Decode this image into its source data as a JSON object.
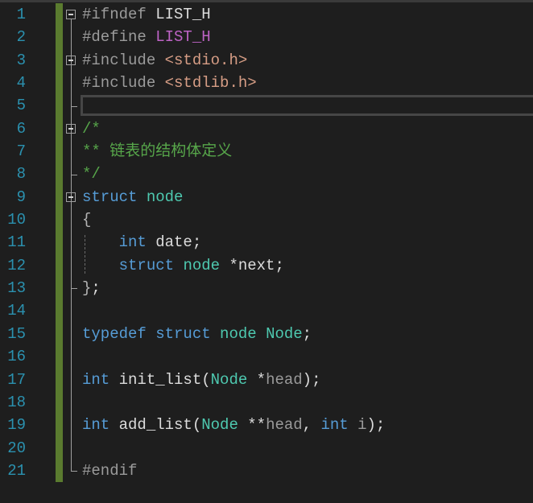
{
  "editor": {
    "current_line": 5,
    "colors": {
      "line_number": "#2b91af",
      "keyword": "#569cd6",
      "type": "#4ec9b0",
      "comment": "#57a64a",
      "string": "#d69d85",
      "macro": "#bd63c5",
      "preprocessor": "#9b9b9b",
      "change_bar": "#5a7b2f",
      "background": "#1e1e1e"
    },
    "lines": [
      {
        "n": "1",
        "tokens": [
          [
            "#ifndef ",
            "pp"
          ],
          [
            "LIST_H",
            "pl"
          ]
        ]
      },
      {
        "n": "2",
        "tokens": [
          [
            "#define ",
            "pp"
          ],
          [
            "LIST_H",
            "macro"
          ]
        ]
      },
      {
        "n": "3",
        "tokens": [
          [
            "#include ",
            "pp"
          ],
          [
            "<stdio.h>",
            "str"
          ]
        ]
      },
      {
        "n": "4",
        "tokens": [
          [
            "#include ",
            "pp"
          ],
          [
            "<stdlib.h>",
            "str"
          ]
        ]
      },
      {
        "n": "5",
        "tokens": []
      },
      {
        "n": "6",
        "tokens": [
          [
            "/*",
            "cm"
          ]
        ]
      },
      {
        "n": "7",
        "tokens": [
          [
            "** 链表的结构体定义",
            "cm"
          ]
        ]
      },
      {
        "n": "8",
        "tokens": [
          [
            "*/",
            "cm"
          ]
        ]
      },
      {
        "n": "9",
        "tokens": [
          [
            "struct ",
            "kw"
          ],
          [
            "node",
            "type"
          ]
        ]
      },
      {
        "n": "10",
        "tokens": [
          [
            "{",
            "br"
          ]
        ]
      },
      {
        "n": "11",
        "tokens": [
          [
            "    ",
            "pl"
          ],
          [
            "int ",
            "kw"
          ],
          [
            "date;",
            "pl"
          ]
        ]
      },
      {
        "n": "12",
        "tokens": [
          [
            "    ",
            "pl"
          ],
          [
            "struct ",
            "kw"
          ],
          [
            "node ",
            "type"
          ],
          [
            "*next;",
            "pl"
          ]
        ]
      },
      {
        "n": "13",
        "tokens": [
          [
            "}",
            "br"
          ],
          [
            ";",
            "pl"
          ]
        ]
      },
      {
        "n": "14",
        "tokens": []
      },
      {
        "n": "15",
        "tokens": [
          [
            "typedef ",
            "kw"
          ],
          [
            "struct ",
            "kw"
          ],
          [
            "node ",
            "type"
          ],
          [
            "Node",
            "type"
          ],
          [
            ";",
            "pl"
          ]
        ]
      },
      {
        "n": "16",
        "tokens": []
      },
      {
        "n": "17",
        "tokens": [
          [
            "int ",
            "kw"
          ],
          [
            "init_list(",
            "pl"
          ],
          [
            "Node ",
            "type"
          ],
          [
            "*",
            "pl"
          ],
          [
            "head",
            "param"
          ],
          [
            ");",
            "pl"
          ]
        ]
      },
      {
        "n": "18",
        "tokens": []
      },
      {
        "n": "19",
        "tokens": [
          [
            "int ",
            "kw"
          ],
          [
            "add_list(",
            "pl"
          ],
          [
            "Node ",
            "type"
          ],
          [
            "**",
            "pl"
          ],
          [
            "head",
            "param"
          ],
          [
            ", ",
            "pl"
          ],
          [
            "int ",
            "kw"
          ],
          [
            "i",
            "param"
          ],
          [
            ");",
            "pl"
          ]
        ]
      },
      {
        "n": "20",
        "tokens": []
      },
      {
        "n": "21",
        "tokens": [
          [
            "#endif",
            "pp"
          ]
        ]
      }
    ],
    "fold_lines": [
      1,
      3,
      6,
      9
    ]
  }
}
